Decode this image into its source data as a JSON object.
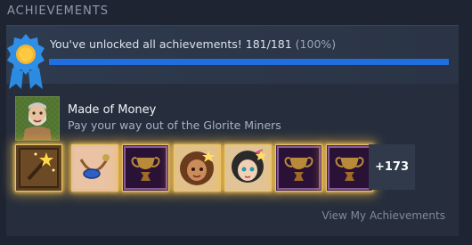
{
  "section": {
    "title": "ACHIEVEMENTS"
  },
  "summary": {
    "text": "You've unlocked all achievements! 181/181",
    "percent_text": "(100%)",
    "progress": 1.0,
    "icon": "blue-ribbon-gold-medal-icon"
  },
  "featured": {
    "title": "Made of Money",
    "description": "Pay your way out of the Glorite Miners",
    "icon": "bearded-man-portrait-icon"
  },
  "achievement_icons": [
    {
      "name": "magic-wand-icon"
    },
    {
      "name": "blue-amulet-necklace-icon"
    },
    {
      "name": "trophy-hourglass-icon"
    },
    {
      "name": "curly-haired-girl-portrait-icon"
    },
    {
      "name": "teal-haired-girl-portrait-icon"
    },
    {
      "name": "trophy-hourglass-icon"
    },
    {
      "name": "trophy-hourglass-icon"
    }
  ],
  "more_count": "+173",
  "link": {
    "label": "View My Achievements"
  },
  "colors": {
    "progress": "#1f6fe0",
    "background": "#1e2432",
    "glow": "#ffbe3c"
  }
}
